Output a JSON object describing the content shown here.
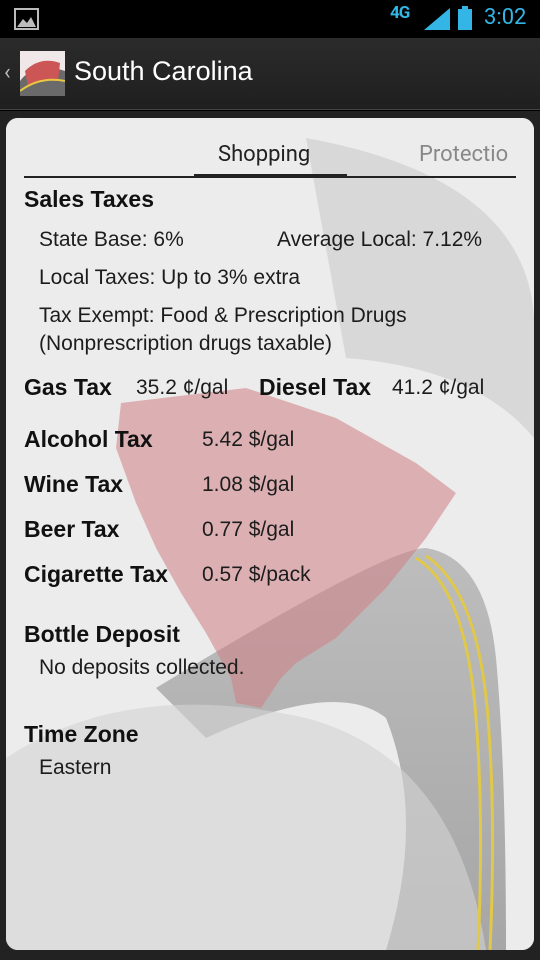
{
  "status_bar": {
    "network": "4G",
    "clock": "3:02",
    "accent": "#33b5e5"
  },
  "action_bar": {
    "title": "South Carolina"
  },
  "tabs": {
    "items": [
      "Shopping",
      "Protectio"
    ],
    "active": "Shopping"
  },
  "sales_taxes": {
    "heading": "Sales Taxes",
    "state_base": "State Base: 6%",
    "average_local": "Average Local: 7.12%",
    "local_taxes": "Local Taxes: Up to 3% extra",
    "exempt_line1": "Tax Exempt: Food & Prescription Drugs",
    "exempt_line2": "(Nonprescription drugs taxable)"
  },
  "fuel": {
    "gas_label": "Gas Tax",
    "gas_value": "35.2 ¢/gal",
    "diesel_label": "Diesel Tax",
    "diesel_value": "41.2 ¢/gal"
  },
  "excise": [
    {
      "label": "Alcohol Tax",
      "value": "5.42 $/gal"
    },
    {
      "label": "Wine Tax",
      "value": "1.08 $/gal"
    },
    {
      "label": "Beer Tax",
      "value": "0.77 $/gal"
    },
    {
      "label": "Cigarette Tax",
      "value": "0.57 $/pack"
    }
  ],
  "bottle_deposit": {
    "heading": "Bottle Deposit",
    "value": "No deposits collected."
  },
  "time_zone": {
    "heading": "Time Zone",
    "value": "Eastern"
  }
}
